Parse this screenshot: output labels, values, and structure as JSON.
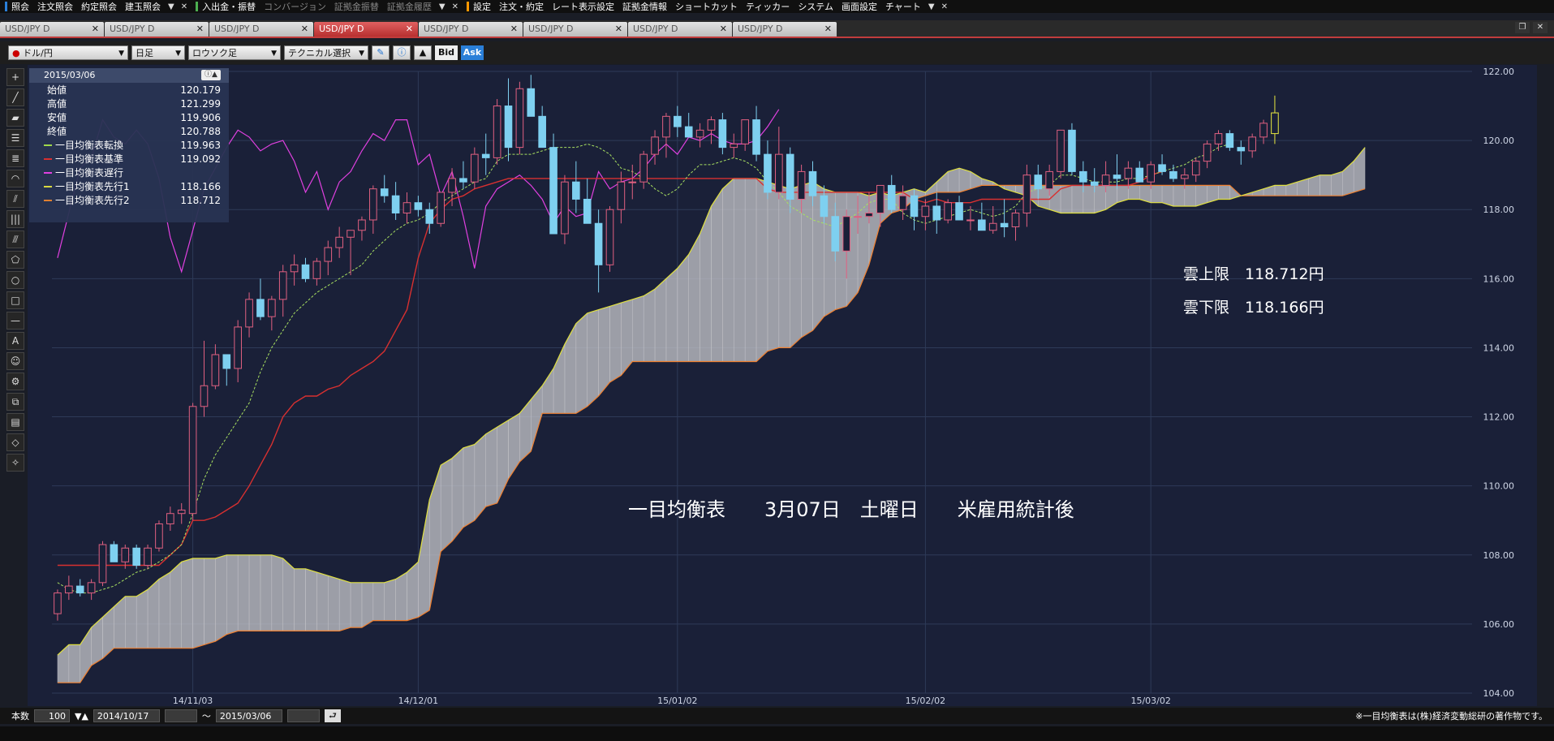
{
  "menubar": {
    "items": [
      "照会",
      "注文照会",
      "約定照会",
      "建玉照会",
      "入出金・振替",
      "コンバージョン",
      "証拠金振替",
      "証拠金履歴",
      "設定",
      "注文・約定",
      "レート表示設定",
      "証拠金情報",
      "ショートカット",
      "ティッカー",
      "システム",
      "画面設定",
      "チャート"
    ],
    "dim_items": [
      5,
      6,
      7
    ],
    "separator_colors": [
      "#2a7fd8",
      "#4caf50",
      "#ff9800"
    ]
  },
  "tabs": [
    {
      "label": "USD/JPY D",
      "active": false
    },
    {
      "label": "USD/JPY D",
      "active": false
    },
    {
      "label": "USD/JPY D",
      "active": false
    },
    {
      "label": "USD/JPY D",
      "active": true
    },
    {
      "label": "USD/JPY D",
      "active": false
    },
    {
      "label": "USD/JPY D",
      "active": false
    },
    {
      "label": "USD/JPY D",
      "active": false
    },
    {
      "label": "USD/JPY D",
      "active": false
    }
  ],
  "toolbar": {
    "currency_pair": "ドル/円",
    "timeframe": "日足",
    "chart_type": "ロウソク足",
    "technical_select": "テクニカル選択",
    "bid_label": "Bid",
    "ask_label": "Ask"
  },
  "info_panel": {
    "date": "2015/03/06",
    "rows": [
      {
        "label": "始値",
        "value": "120.179",
        "color": ""
      },
      {
        "label": "高値",
        "value": "121.299",
        "color": ""
      },
      {
        "label": "安値",
        "value": "119.906",
        "color": ""
      },
      {
        "label": "終値",
        "value": "120.788",
        "color": ""
      },
      {
        "label": "一目均衡表転換",
        "value": "119.963",
        "color": "#9fd84a"
      },
      {
        "label": "一目均衡表基準",
        "value": "119.092",
        "color": "#d83030"
      },
      {
        "label": "一目均衡表遅行",
        "value": "",
        "color": "#e040e0"
      },
      {
        "label": "一目均衡表先行1",
        "value": "118.166",
        "color": "#d8d840"
      },
      {
        "label": "一目均衡表先行2",
        "value": "118.712",
        "color": "#e08030"
      }
    ]
  },
  "annotations": {
    "main_text": "一目均衡表　　3月07日　土曜日　　米雇用統計後",
    "cloud_upper": "雲上限　118.712円",
    "cloud_lower": "雲下限　118.166円"
  },
  "bottombar": {
    "count_label": "本数",
    "count_value": "100",
    "from_date": "2014/10/17",
    "tilde": "～",
    "to_date": "2015/03/06",
    "copyright": "※一目均衡表は(株)経済変動総研の著作物です。"
  },
  "chart_data": {
    "type": "candlestick",
    "title": "",
    "ylim": [
      104.0,
      122.0
    ],
    "y_ticks": [
      "104.00",
      "106.00",
      "108.00",
      "110.00",
      "112.00",
      "114.00",
      "116.00",
      "118.00",
      "120.00",
      "122.00"
    ],
    "x_ticks": [
      {
        "label": "14/11/03",
        "index": 12
      },
      {
        "label": "14/12/01",
        "index": 32
      },
      {
        "label": "15/01/02",
        "index": 55
      },
      {
        "label": "15/02/02",
        "index": 77
      },
      {
        "label": "15/03/02",
        "index": 97
      }
    ],
    "total_slots": 126,
    "ohlc": [
      [
        106.3,
        107.0,
        106.1,
        106.9
      ],
      [
        106.9,
        107.4,
        106.7,
        107.1
      ],
      [
        107.1,
        107.3,
        106.8,
        106.9
      ],
      [
        106.9,
        107.3,
        106.7,
        107.2
      ],
      [
        107.2,
        108.4,
        107.1,
        108.3
      ],
      [
        108.3,
        108.4,
        107.8,
        107.8
      ],
      [
        107.8,
        108.3,
        107.6,
        108.2
      ],
      [
        108.2,
        108.3,
        107.6,
        107.7
      ],
      [
        107.7,
        108.3,
        107.6,
        108.2
      ],
      [
        108.2,
        109.0,
        108.1,
        108.9
      ],
      [
        108.9,
        109.4,
        108.7,
        109.2
      ],
      [
        109.2,
        109.5,
        108.9,
        109.3
      ],
      [
        109.2,
        112.4,
        109.0,
        112.3
      ],
      [
        112.3,
        114.2,
        112.0,
        112.9
      ],
      [
        112.9,
        114.1,
        112.8,
        113.8
      ],
      [
        113.8,
        113.8,
        112.9,
        113.4
      ],
      [
        113.4,
        114.8,
        113.0,
        114.6
      ],
      [
        114.6,
        115.6,
        114.3,
        115.4
      ],
      [
        115.4,
        116.0,
        114.8,
        114.9
      ],
      [
        114.9,
        115.5,
        114.5,
        115.4
      ],
      [
        115.4,
        116.4,
        114.9,
        116.2
      ],
      [
        116.2,
        116.7,
        115.8,
        116.4
      ],
      [
        116.4,
        116.6,
        115.9,
        116.0
      ],
      [
        116.0,
        116.6,
        115.8,
        116.5
      ],
      [
        116.5,
        117.1,
        116.1,
        116.9
      ],
      [
        116.9,
        117.5,
        116.6,
        117.2
      ],
      [
        117.2,
        117.4,
        116.1,
        117.4
      ],
      [
        117.4,
        117.8,
        117.1,
        117.7
      ],
      [
        117.7,
        118.7,
        117.3,
        118.6
      ],
      [
        118.6,
        119.0,
        118.2,
        118.4
      ],
      [
        118.4,
        118.8,
        117.7,
        117.9
      ],
      [
        117.9,
        118.5,
        117.6,
        118.2
      ],
      [
        118.2,
        118.4,
        117.8,
        118.0
      ],
      [
        118.0,
        118.2,
        117.3,
        117.6
      ],
      [
        117.6,
        118.5,
        117.5,
        118.5
      ],
      [
        118.5,
        119.2,
        118.1,
        118.9
      ],
      [
        118.9,
        119.4,
        118.6,
        118.8
      ],
      [
        118.8,
        119.8,
        118.6,
        119.6
      ],
      [
        119.6,
        120.2,
        119.0,
        119.5
      ],
      [
        119.5,
        121.2,
        119.3,
        121.0
      ],
      [
        121.0,
        121.8,
        119.4,
        119.8
      ],
      [
        119.8,
        121.7,
        119.6,
        121.5
      ],
      [
        121.5,
        121.9,
        120.7,
        120.7
      ],
      [
        120.7,
        121.0,
        119.9,
        119.8
      ],
      [
        119.8,
        120.2,
        117.3,
        117.3
      ],
      [
        117.3,
        119.0,
        117.0,
        118.8
      ],
      [
        118.8,
        119.4,
        117.9,
        118.3
      ],
      [
        118.3,
        118.9,
        117.8,
        117.6
      ],
      [
        117.6,
        118.0,
        115.6,
        116.4
      ],
      [
        116.4,
        118.1,
        116.2,
        118.0
      ],
      [
        118.0,
        119.1,
        117.6,
        118.8
      ],
      [
        118.8,
        119.3,
        118.3,
        118.8
      ],
      [
        118.8,
        119.7,
        118.6,
        119.6
      ],
      [
        119.6,
        120.3,
        119.3,
        120.1
      ],
      [
        120.1,
        120.8,
        119.5,
        120.7
      ],
      [
        120.7,
        121.0,
        120.1,
        120.4
      ],
      [
        120.4,
        120.8,
        120.1,
        120.1
      ],
      [
        120.1,
        120.5,
        119.8,
        120.3
      ],
      [
        120.3,
        120.7,
        119.9,
        120.6
      ],
      [
        120.6,
        120.8,
        119.6,
        119.8
      ],
      [
        119.8,
        120.2,
        119.5,
        119.9
      ],
      [
        119.9,
        120.6,
        119.7,
        120.6
      ],
      [
        120.6,
        121.0,
        119.4,
        119.6
      ],
      [
        119.6,
        120.0,
        118.3,
        118.5
      ],
      [
        118.5,
        120.4,
        118.3,
        119.6
      ],
      [
        119.6,
        119.8,
        117.9,
        118.3
      ],
      [
        118.3,
        119.3,
        117.9,
        119.1
      ],
      [
        119.1,
        119.4,
        118.1,
        118.4
      ],
      [
        118.4,
        118.7,
        117.6,
        117.8
      ],
      [
        117.8,
        118.2,
        116.5,
        116.8
      ],
      [
        116.8,
        118.0,
        116.0,
        117.8
      ],
      [
        117.8,
        118.4,
        117.3,
        117.8
      ],
      [
        117.8,
        118.5,
        117.6,
        117.9
      ],
      [
        117.9,
        118.7,
        117.5,
        118.7
      ],
      [
        118.7,
        119.0,
        117.9,
        118.0
      ],
      [
        118.0,
        118.7,
        117.7,
        118.4
      ],
      [
        118.4,
        118.6,
        117.4,
        117.8
      ],
      [
        117.8,
        118.3,
        117.4,
        118.1
      ],
      [
        118.1,
        118.5,
        117.3,
        117.7
      ],
      [
        117.7,
        118.3,
        117.6,
        118.2
      ],
      [
        118.2,
        118.4,
        117.7,
        117.7
      ],
      [
        117.7,
        118.1,
        117.4,
        117.7
      ],
      [
        117.7,
        118.2,
        117.4,
        117.4
      ],
      [
        117.4,
        118.1,
        117.3,
        117.6
      ],
      [
        117.6,
        118.3,
        117.2,
        117.5
      ],
      [
        117.5,
        118.0,
        117.1,
        117.9
      ],
      [
        117.9,
        119.3,
        117.5,
        119.0
      ],
      [
        119.0,
        119.3,
        118.3,
        118.6
      ],
      [
        118.6,
        119.3,
        118.4,
        119.1
      ],
      [
        119.1,
        120.2,
        118.9,
        120.3
      ],
      [
        120.3,
        120.5,
        119.0,
        119.1
      ],
      [
        119.1,
        119.4,
        118.5,
        118.8
      ],
      [
        118.8,
        119.2,
        118.5,
        118.7
      ],
      [
        118.7,
        119.4,
        118.5,
        119.0
      ],
      [
        119.0,
        119.6,
        118.6,
        118.9
      ],
      [
        118.9,
        119.4,
        118.6,
        119.2
      ],
      [
        119.2,
        119.4,
        118.8,
        118.8
      ],
      [
        118.8,
        119.4,
        118.6,
        119.3
      ],
      [
        119.3,
        119.6,
        119.0,
        119.1
      ],
      [
        119.1,
        119.3,
        118.8,
        118.9
      ],
      [
        118.9,
        119.2,
        118.6,
        119.0
      ],
      [
        119.0,
        119.5,
        118.8,
        119.4
      ],
      [
        119.4,
        120.0,
        119.2,
        119.9
      ],
      [
        119.9,
        120.3,
        119.7,
        120.2
      ],
      [
        120.2,
        120.3,
        119.7,
        119.8
      ],
      [
        119.8,
        120.0,
        119.3,
        119.7
      ],
      [
        119.7,
        120.2,
        119.5,
        120.1
      ],
      [
        120.1,
        120.6,
        119.9,
        120.5
      ],
      [
        120.2,
        121.3,
        119.9,
        120.8
      ]
    ],
    "tenkan": [
      107.2,
      107.0,
      106.9,
      106.9,
      107.0,
      107.1,
      107.3,
      107.5,
      107.6,
      107.8,
      108.0,
      108.3,
      109.2,
      110.2,
      110.9,
      111.4,
      111.9,
      112.4,
      113.3,
      114.0,
      114.5,
      115.0,
      115.3,
      115.6,
      115.8,
      116.0,
      116.2,
      116.4,
      116.8,
      117.1,
      117.4,
      117.6,
      117.7,
      117.9,
      118.2,
      118.4,
      118.6,
      118.8,
      118.9,
      119.4,
      119.6,
      119.6,
      119.6,
      119.7,
      119.8,
      119.8,
      119.8,
      119.9,
      119.8,
      119.6,
      119.2,
      119.1,
      118.9,
      118.6,
      118.4,
      118.6,
      119.0,
      119.3,
      119.3,
      119.4,
      119.5,
      119.4,
      119.2,
      118.8,
      118.5,
      118.1,
      117.9,
      117.7,
      117.6,
      117.5,
      117.7,
      117.9,
      118.2,
      118.3,
      118.3,
      117.9,
      117.7,
      117.6,
      117.7,
      117.8,
      117.9,
      118.0,
      117.9,
      117.8,
      117.9,
      118.1,
      118.5,
      118.6,
      118.7,
      119.0,
      119.0,
      118.9,
      118.8,
      118.8,
      118.8,
      118.9,
      118.9,
      119.0,
      119.1,
      119.2,
      119.3,
      119.5,
      119.6,
      119.8,
      119.9
    ],
    "kijun": [
      107.7,
      107.7,
      107.7,
      107.7,
      107.7,
      107.7,
      107.7,
      107.7,
      107.7,
      107.7,
      108.0,
      108.3,
      109.0,
      109.0,
      109.1,
      109.3,
      109.5,
      110.0,
      110.6,
      111.2,
      112.0,
      112.4,
      112.6,
      112.6,
      112.8,
      112.9,
      113.2,
      113.4,
      113.6,
      113.9,
      114.5,
      115.1,
      116.6,
      117.6,
      118.0,
      118.3,
      118.4,
      118.6,
      118.7,
      118.8,
      118.9,
      118.9,
      118.9,
      118.9,
      118.9,
      118.9,
      118.9,
      118.9,
      118.9,
      118.9,
      118.9,
      118.9,
      118.9,
      118.9,
      118.9,
      118.9,
      118.9,
      118.9,
      118.9,
      118.9,
      118.9,
      118.9,
      118.9,
      118.6,
      118.5,
      118.5,
      118.5,
      118.5,
      118.5,
      118.5,
      118.5,
      118.5,
      118.5,
      118.5,
      118.5,
      118.5,
      118.3,
      118.2,
      118.3,
      118.2,
      118.2,
      118.2,
      118.3,
      118.3,
      118.3,
      118.3,
      118.3,
      118.3,
      118.3,
      118.6,
      118.7,
      118.7,
      118.7,
      118.7,
      118.7,
      118.7,
      118.8,
      119.0,
      119.1
    ],
    "chikou": [
      116.6,
      117.9,
      119.2,
      119.5,
      120.6,
      120.1,
      119.9,
      120.3,
      119.9,
      118.9,
      117.2,
      116.2,
      117.4,
      118.6,
      119.2,
      119.8,
      120.3,
      120.1,
      119.7,
      119.9,
      120.0,
      119.4,
      118.5,
      119.1,
      118.0,
      118.8,
      119.1,
      119.7,
      120.2,
      120.0,
      120.6,
      120.6,
      119.3,
      119.6,
      118.4,
      119.1,
      117.8,
      116.3,
      118.1,
      118.6,
      118.8,
      119.0,
      118.7,
      118.3,
      117.6,
      118.1,
      117.8,
      117.9,
      119.1,
      118.6,
      118.8,
      118.9,
      119.2,
      119.6,
      119.9,
      119.6,
      120.1,
      120.0,
      120.2,
      120.0,
      119.9,
      119.9,
      120.0,
      120.4,
      120.9
    ],
    "senkou1": [
      105.1,
      105.4,
      105.4,
      105.9,
      106.2,
      106.5,
      106.8,
      106.8,
      107.0,
      107.3,
      107.5,
      107.8,
      107.9,
      107.9,
      107.9,
      108.0,
      108.0,
      108.0,
      108.0,
      108.0,
      107.9,
      107.6,
      107.6,
      107.5,
      107.4,
      107.3,
      107.2,
      107.2,
      107.2,
      107.2,
      107.3,
      107.5,
      107.8,
      109.6,
      110.6,
      110.8,
      111.1,
      111.2,
      111.5,
      111.7,
      111.9,
      112.1,
      112.5,
      112.9,
      113.4,
      114.1,
      114.7,
      115.0,
      115.1,
      115.2,
      115.3,
      115.4,
      115.5,
      115.7,
      116.0,
      116.3,
      116.7,
      117.3,
      118.1,
      118.6,
      118.9,
      118.9,
      118.9,
      118.8,
      118.7,
      118.6,
      118.7,
      118.8,
      118.6,
      118.5,
      118.5,
      118.5,
      118.4,
      118.5,
      118.4,
      118.5,
      118.6,
      118.5,
      118.8,
      119.1,
      119.2,
      119.1,
      118.9,
      118.8,
      118.6,
      118.5,
      118.4,
      118.1,
      118.0,
      117.9,
      117.9,
      117.9,
      117.9,
      118.0,
      118.2,
      118.3,
      118.3,
      118.2,
      118.2,
      118.1,
      118.1,
      118.1,
      118.2,
      118.3,
      118.3,
      118.4,
      118.5,
      118.6,
      118.7,
      118.7,
      118.8,
      118.9,
      119.0,
      119.0,
      119.1,
      119.4,
      119.8
    ],
    "senkou2": [
      104.3,
      104.3,
      104.3,
      104.8,
      105.0,
      105.3,
      105.3,
      105.3,
      105.3,
      105.3,
      105.3,
      105.3,
      105.3,
      105.4,
      105.5,
      105.7,
      105.8,
      105.8,
      105.8,
      105.8,
      105.8,
      105.8,
      105.8,
      105.8,
      105.8,
      105.8,
      105.9,
      105.9,
      106.1,
      106.1,
      106.1,
      106.1,
      106.2,
      106.4,
      108.1,
      108.4,
      108.8,
      109.0,
      109.4,
      109.5,
      110.2,
      110.7,
      111.0,
      112.1,
      112.1,
      112.1,
      112.1,
      112.3,
      112.6,
      113.0,
      113.2,
      113.6,
      113.6,
      113.6,
      113.6,
      113.6,
      113.6,
      113.6,
      113.6,
      113.6,
      113.6,
      113.6,
      113.6,
      113.9,
      114.0,
      114.0,
      114.3,
      114.5,
      114.9,
      115.1,
      115.2,
      115.6,
      116.4,
      117.6,
      117.9,
      118.0,
      118.3,
      118.4,
      118.5,
      118.5,
      118.5,
      118.6,
      118.7,
      118.7,
      118.7,
      118.7,
      118.7,
      118.7,
      118.7,
      118.7,
      118.7,
      118.7,
      118.7,
      118.7,
      118.7,
      118.7,
      118.7,
      118.7,
      118.7,
      118.7,
      118.7,
      118.7,
      118.7,
      118.7,
      118.7,
      118.4,
      118.4,
      118.4,
      118.4,
      118.4,
      118.4,
      118.4,
      118.4,
      118.4,
      118.4,
      118.5,
      118.6
    ]
  },
  "colors": {
    "bg_chart": "#1a2038",
    "grid": "#2e3a58",
    "candle_up_border": "#e06080",
    "candle_up_fill": "#1a2038",
    "candle_down": "#7ed0f0",
    "last_candle": "#e8e840",
    "tenkan": "#a8e060",
    "kijun": "#d83030",
    "chikou": "#e040e0",
    "senkou1": "#e0e040",
    "senkou2": "#f08030",
    "cloud_fill": "#c8c8cc"
  }
}
